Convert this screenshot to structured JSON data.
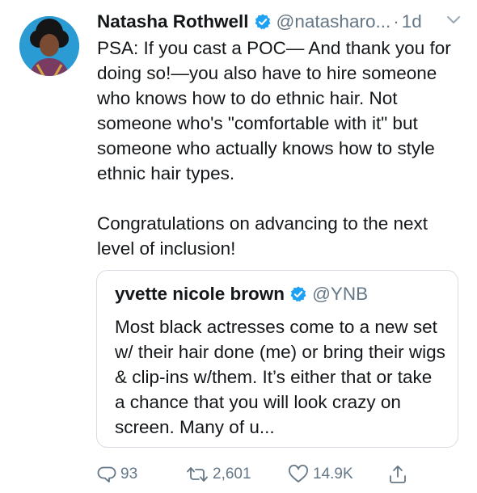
{
  "author": {
    "display_name": "Natasha Rothwell",
    "handle": "@natasharo...",
    "separator": "·",
    "time": "1d"
  },
  "tweet": {
    "paragraphs": [
      "PSA: If you cast a POC— And thank you for doing so!—you also have to hire someone who knows how to do ethnic hair. Not someone who's \"comfortable with it\" but someone who actually knows how to style ethnic hair types.",
      "Congratulations on advancing to the next level of inclusion!"
    ]
  },
  "quoted_tweet": {
    "display_name": "yvette nicole brown",
    "handle": "@YNB",
    "text": "Most black actresses come to a new set w/ their hair done (me) or bring their wigs & clip-ins w/them. It’s either that or take a chance that you will look crazy on screen. Many of u..."
  },
  "actions": {
    "replies": "93",
    "retweets": "2,601",
    "likes": "14.9K"
  },
  "icons": {
    "verified": "verified-badge-icon",
    "more": "chevron-down-icon",
    "reply": "reply-icon",
    "retweet": "retweet-icon",
    "like": "heart-icon",
    "share": "share-icon"
  },
  "colors": {
    "verified_blue": "#1da1f2",
    "secondary_text": "#657786",
    "primary_text": "#14171a",
    "card_border": "#d7dde2"
  }
}
